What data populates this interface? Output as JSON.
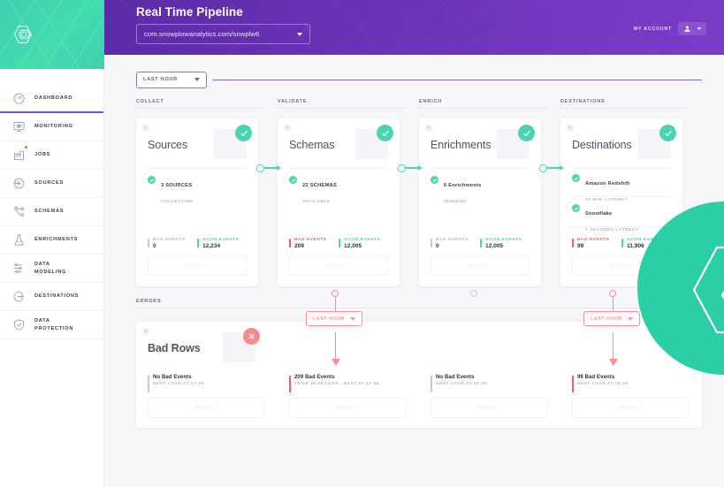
{
  "brand": {
    "logo_icon": "snowplow-hexagon-logo"
  },
  "sidebar": {
    "items": [
      {
        "label": "DASHBOARD",
        "icon": "gauge-icon",
        "active": true,
        "badge": false
      },
      {
        "label": "MONITORING",
        "icon": "monitor-eye-icon",
        "active": false,
        "badge": false
      },
      {
        "label": "JOBS",
        "icon": "factory-chart-icon",
        "active": false,
        "badge": true
      },
      {
        "label": "SOURCES",
        "icon": "arrow-into-circle-icon",
        "active": false,
        "badge": false
      },
      {
        "label": "SCHEMAS",
        "icon": "nodes-branch-icon",
        "active": false,
        "badge": false
      },
      {
        "label": "ENRICHMENTS",
        "icon": "flask-icon",
        "active": false,
        "badge": false
      },
      {
        "label": "DATA\nMODELING",
        "icon": "sliders-icon",
        "active": false,
        "badge": false
      },
      {
        "label": "DESTINATIONS",
        "icon": "arrow-out-circle-icon",
        "active": false,
        "badge": false
      },
      {
        "label": "DATA\nPROTECTION",
        "icon": "shield-check-icon",
        "active": false,
        "badge": false
      }
    ]
  },
  "header": {
    "title": "Real Time Pipeline",
    "url_value": "com.snowplowanalytics.com/snwplw6",
    "url_caret_icon": "chevron-down-icon",
    "account_label": "MY ACCOUNT",
    "account_icon": "user-icon",
    "account_caret_icon": "chevron-down-icon"
  },
  "timeframe": {
    "label": "LAST HOUR",
    "caret_icon": "chevron-down-icon"
  },
  "pipeline": {
    "columns": [
      "COLLECT",
      "VALIDATE",
      "ENRICH",
      "DESTINATIONS"
    ],
    "cards": [
      {
        "title": "Sources",
        "status": "ok",
        "status_icon": "check-circle-icon",
        "info_icon": "info-icon",
        "rows": [
          {
            "main": "3 SOURCES",
            "sub": "COLLECTING",
            "icon": "check-circle-icon"
          }
        ],
        "bad_label": "BAD EVENTS",
        "bad_value": "0",
        "bad_alert": false,
        "good_label": "GOOD EVENTS",
        "good_value": "12,234",
        "button": "INSPECT"
      },
      {
        "title": "Schemas",
        "status": "ok",
        "status_icon": "check-circle-icon",
        "info_icon": "info-icon",
        "rows": [
          {
            "main": "22 SCHEMAS",
            "sub": "AVAILABLE",
            "icon": "check-circle-icon"
          }
        ],
        "bad_label": "BAD EVENTS",
        "bad_value": "209",
        "bad_alert": true,
        "good_label": "GOOD EVENTS",
        "good_value": "12,005",
        "button": "INSPECT"
      },
      {
        "title": "Enrichments",
        "status": "ok",
        "status_icon": "check-circle-icon",
        "info_icon": "info-icon",
        "rows": [
          {
            "main": "6 Enrichments",
            "sub": "RUNNING",
            "icon": "check-circle-icon"
          }
        ],
        "bad_label": "BAD EVENTS",
        "bad_value": "0",
        "bad_alert": false,
        "good_label": "GOOD EVENTS",
        "good_value": "12,005",
        "button": "INSPECT"
      },
      {
        "title": "Destinations",
        "status": "ok",
        "status_icon": "check-circle-icon",
        "info_icon": "info-icon",
        "rows": [
          {
            "main": "Amazon Redshift",
            "sub": "30 MIN. LATENCY",
            "icon": "check-circle-icon"
          },
          {
            "main": "Snowflake",
            "sub": "7 SECONDS LATENCY",
            "icon": "check-circle-icon"
          }
        ],
        "bad_label": "BAD EVENTS",
        "bad_value": "99",
        "bad_alert": true,
        "good_label": "GOOD EVENTS",
        "good_value": "11,906",
        "button": "INSPECT"
      }
    ]
  },
  "errors": {
    "section_label": "ERRORS",
    "panel_title": "Bad Rows",
    "panel_status": "error",
    "panel_status_icon": "close-circle-icon",
    "info_icon": "info-icon",
    "filters": [
      {
        "label": "LAST HOUR",
        "caret_icon": "chevron-down-icon"
      },
      {
        "label": "LAST HOUR",
        "caret_icon": "chevron-down-icon"
      }
    ],
    "columns": [
      {
        "headline": "No Bad Events",
        "sub": "NEXT LOAD AT 17:30",
        "alert": false,
        "button": "INSPECT"
      },
      {
        "headline": "209 Bad Events",
        "sub": "FROM 16:45 LOAD , NEXT AT 17:45",
        "alert": true,
        "button": "INSPECT"
      },
      {
        "headline": "No Bad Events",
        "sub": "NEXT LOAD AT 18:00",
        "alert": false,
        "button": "INSPECT"
      },
      {
        "headline": "99 Bad Events",
        "sub": "NEXT LOAD AT 18:20",
        "alert": true,
        "button": "INSPECT"
      }
    ]
  },
  "decor": {
    "circle_logo_icon": "snowplow-hexagon-logo"
  },
  "colors": {
    "purple": "#6a33b8",
    "teal": "#4ad5b0",
    "red": "#fc5c65",
    "accent_purple": "#7b4fd1"
  }
}
